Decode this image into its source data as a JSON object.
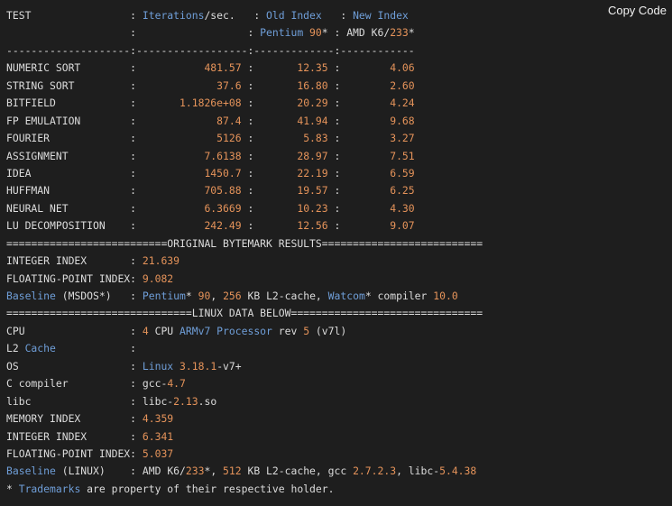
{
  "copy_button_label": "Copy Code",
  "colors": {
    "background": "#1e1e1e",
    "text": "#dcdcdc",
    "keyword": "#6f9ed8",
    "number": "#e5935a"
  },
  "header": [
    [
      {
        "t": "TEST                "
      },
      {
        "t": ": "
      },
      {
        "t": "Iterations",
        "c": "b"
      },
      {
        "t": "/sec.   : "
      },
      {
        "t": "Old Index",
        "c": "b"
      },
      {
        "t": "   : "
      },
      {
        "t": "New Index",
        "c": "b"
      }
    ],
    [
      {
        "t": "                    :                  : "
      },
      {
        "t": "Pentium",
        "c": "b"
      },
      {
        "t": " "
      },
      {
        "t": "90",
        "c": "o"
      },
      {
        "t": "* : AMD K6/"
      },
      {
        "t": "233",
        "c": "o"
      },
      {
        "t": "*"
      }
    ],
    [
      {
        "t": "--------------------:------------------:-------------:------------"
      }
    ]
  ],
  "benchmarks": [
    {
      "test": "NUMERIC SORT",
      "iterations": "481.57",
      "old_index": "12.35",
      "new_index": "4.06"
    },
    {
      "test": "STRING SORT",
      "iterations": "37.6",
      "old_index": "16.80",
      "new_index": "2.60"
    },
    {
      "test": "BITFIELD",
      "iterations": "1.1826e+08",
      "old_index": "20.29",
      "new_index": "4.24"
    },
    {
      "test": "FP EMULATION",
      "iterations": "87.4",
      "old_index": "41.94",
      "new_index": "9.68"
    },
    {
      "test": "FOURIER",
      "iterations": "5126",
      "old_index": "5.83",
      "new_index": "3.27"
    },
    {
      "test": "ASSIGNMENT",
      "iterations": "7.6138",
      "old_index": "28.97",
      "new_index": "7.51"
    },
    {
      "test": "IDEA",
      "iterations": "1450.7",
      "old_index": "22.19",
      "new_index": "6.59"
    },
    {
      "test": "HUFFMAN",
      "iterations": "705.88",
      "old_index": "19.57",
      "new_index": "6.25"
    },
    {
      "test": "NEURAL NET",
      "iterations": "6.3669",
      "old_index": "10.23",
      "new_index": "4.30"
    },
    {
      "test": "LU DECOMPOSITION",
      "iterations": "242.49",
      "old_index": "12.56",
      "new_index": "9.07"
    }
  ],
  "footer": [
    [
      {
        "t": "==========================ORIGINAL BYTEMARK RESULTS=========================="
      }
    ],
    [
      {
        "t": "INTEGER INDEX       : "
      },
      {
        "t": "21.639",
        "c": "o"
      }
    ],
    [
      {
        "t": "FLOATING-POINT INDEX: "
      },
      {
        "t": "9.082",
        "c": "o"
      }
    ],
    [
      {
        "t": "Baseline",
        "c": "b"
      },
      {
        "t": " (MSDOS*)   : "
      },
      {
        "t": "Pentium",
        "c": "b"
      },
      {
        "t": "* "
      },
      {
        "t": "90",
        "c": "o"
      },
      {
        "t": ", "
      },
      {
        "t": "256",
        "c": "o"
      },
      {
        "t": " KB L2-cache, "
      },
      {
        "t": "Watcom",
        "c": "b"
      },
      {
        "t": "* compiler "
      },
      {
        "t": "10.0",
        "c": "o"
      }
    ],
    [
      {
        "t": "==============================LINUX DATA BELOW==============================="
      }
    ],
    [
      {
        "t": "CPU                 : "
      },
      {
        "t": "4",
        "c": "o"
      },
      {
        "t": " CPU "
      },
      {
        "t": "ARMv7 Processor",
        "c": "b"
      },
      {
        "t": " rev "
      },
      {
        "t": "5",
        "c": "o"
      },
      {
        "t": " (v7l)"
      }
    ],
    [
      {
        "t": "L2 "
      },
      {
        "t": "Cache",
        "c": "b"
      },
      {
        "t": "            :"
      }
    ],
    [
      {
        "t": "OS                  : "
      },
      {
        "t": "Linux",
        "c": "b"
      },
      {
        "t": " "
      },
      {
        "t": "3.18.1",
        "c": "o"
      },
      {
        "t": "-v7+"
      }
    ],
    [
      {
        "t": "C compiler          : gcc-"
      },
      {
        "t": "4.7",
        "c": "o"
      }
    ],
    [
      {
        "t": "libc                : libc-"
      },
      {
        "t": "2.13",
        "c": "o"
      },
      {
        "t": ".so"
      }
    ],
    [
      {
        "t": "MEMORY INDEX        : "
      },
      {
        "t": "4.359",
        "c": "o"
      }
    ],
    [
      {
        "t": "INTEGER INDEX       : "
      },
      {
        "t": "6.341",
        "c": "o"
      }
    ],
    [
      {
        "t": "FLOATING-POINT INDEX: "
      },
      {
        "t": "5.037",
        "c": "o"
      }
    ],
    [
      {
        "t": "Baseline",
        "c": "b"
      },
      {
        "t": " (LINUX)    : AMD K6/"
      },
      {
        "t": "233",
        "c": "o"
      },
      {
        "t": "*, "
      },
      {
        "t": "512",
        "c": "o"
      },
      {
        "t": " KB L2-cache, gcc "
      },
      {
        "t": "2.7.2.3",
        "c": "o"
      },
      {
        "t": ", libc-"
      },
      {
        "t": "5.4.38",
        "c": "o"
      }
    ],
    [
      {
        "t": "* "
      },
      {
        "t": "Trademarks",
        "c": "b"
      },
      {
        "t": " are property of their respective holder."
      }
    ]
  ]
}
